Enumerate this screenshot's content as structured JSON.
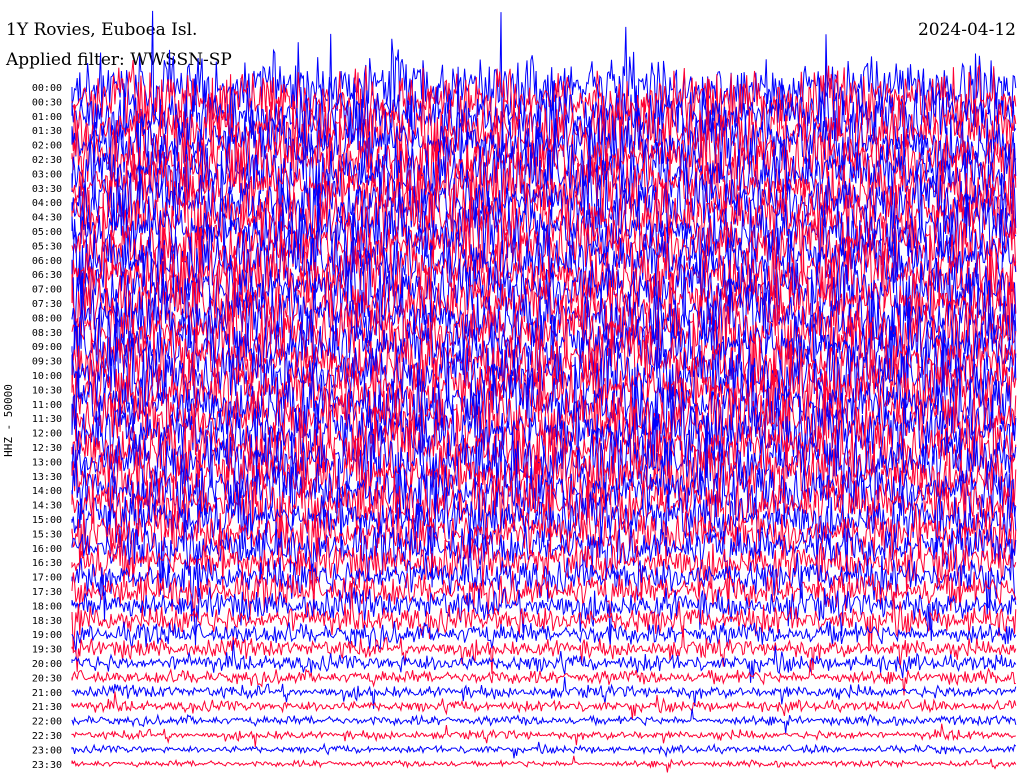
{
  "header": {
    "station": "1Y Rovies, Euboea Isl.",
    "date": "2024-04-12",
    "filter": "Applied filter: WWSSN-SP"
  },
  "colors": {
    "trace_a": "#0000ff",
    "trace_b": "#ff0033",
    "background": "#ffffff"
  },
  "chart_data": {
    "type": "line",
    "title": "1Y Rovies, Euboea Isl.",
    "ylabel": "HHZ - 50000",
    "xlabel": "",
    "row_labels": [
      "00:00",
      "00:30",
      "01:00",
      "01:30",
      "02:00",
      "02:30",
      "03:00",
      "03:30",
      "04:00",
      "04:30",
      "05:00",
      "05:30",
      "06:00",
      "06:30",
      "07:00",
      "07:30",
      "08:00",
      "08:30",
      "09:00",
      "09:30",
      "10:00",
      "10:30",
      "11:00",
      "11:30",
      "12:00",
      "12:30",
      "13:00",
      "13:30",
      "14:00",
      "14:30",
      "15:00",
      "15:30",
      "16:00",
      "16:30",
      "17:00",
      "17:30",
      "18:00",
      "18:30",
      "19:00",
      "19:30",
      "20:00",
      "20:30",
      "21:00",
      "21:30",
      "22:00",
      "22:30",
      "23:00",
      "23:30"
    ],
    "row_colors": [
      "blue",
      "red"
    ],
    "row_amplitude": [
      1.0,
      1.0,
      1.0,
      1.0,
      1.0,
      1.0,
      1.0,
      1.0,
      1.0,
      1.0,
      1.0,
      1.0,
      1.0,
      1.0,
      1.0,
      1.0,
      1.0,
      1.0,
      1.0,
      1.0,
      1.0,
      1.0,
      1.0,
      1.0,
      1.0,
      1.0,
      1.0,
      0.95,
      0.9,
      0.85,
      0.8,
      0.75,
      0.7,
      0.65,
      0.6,
      0.55,
      0.5,
      0.45,
      0.35,
      0.3,
      0.28,
      0.22,
      0.2,
      0.18,
      0.15,
      0.14,
      0.12,
      0.1
    ]
  }
}
